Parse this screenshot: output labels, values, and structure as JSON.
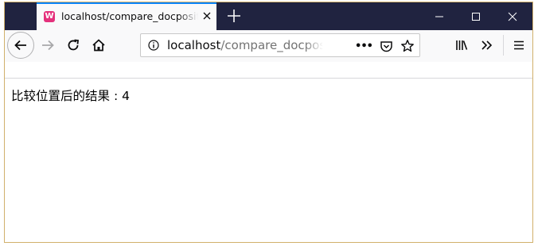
{
  "browser": {
    "tab": {
      "favicon_letter": "W",
      "favicon_icon": "wamp-favicon-icon",
      "title": "localhost/compare_docposit.html",
      "close_icon": "close-icon"
    },
    "new_tab_label": "+",
    "window_controls": [
      "minimize-icon",
      "maximize-icon",
      "close-icon"
    ],
    "toolbar": {
      "back_icon": "back-arrow-icon",
      "forward_icon": "forward-arrow-icon",
      "reload_icon": "reload-icon",
      "home_icon": "home-icon",
      "library_icon": "library-icon",
      "overflow_icon": "chevron-double-right-icon",
      "menu_icon": "hamburger-menu-icon"
    },
    "urlbar": {
      "info_icon": "info-icon",
      "host": "localhost",
      "path": "/compare_docposit.html",
      "page_actions_label": "•••",
      "pocket_icon": "pocket-icon",
      "bookmark_icon": "star-icon"
    }
  },
  "page": {
    "result_label": "比较位置后的结果",
    "result_separator": " : ",
    "result_value": "4"
  },
  "colors": {
    "titlebar": "#202340",
    "tab_active_indicator": "#0a84ff",
    "toolbar": "#f9f9fa",
    "window_border": "#d1b06b",
    "favicon": "#e4317c"
  }
}
